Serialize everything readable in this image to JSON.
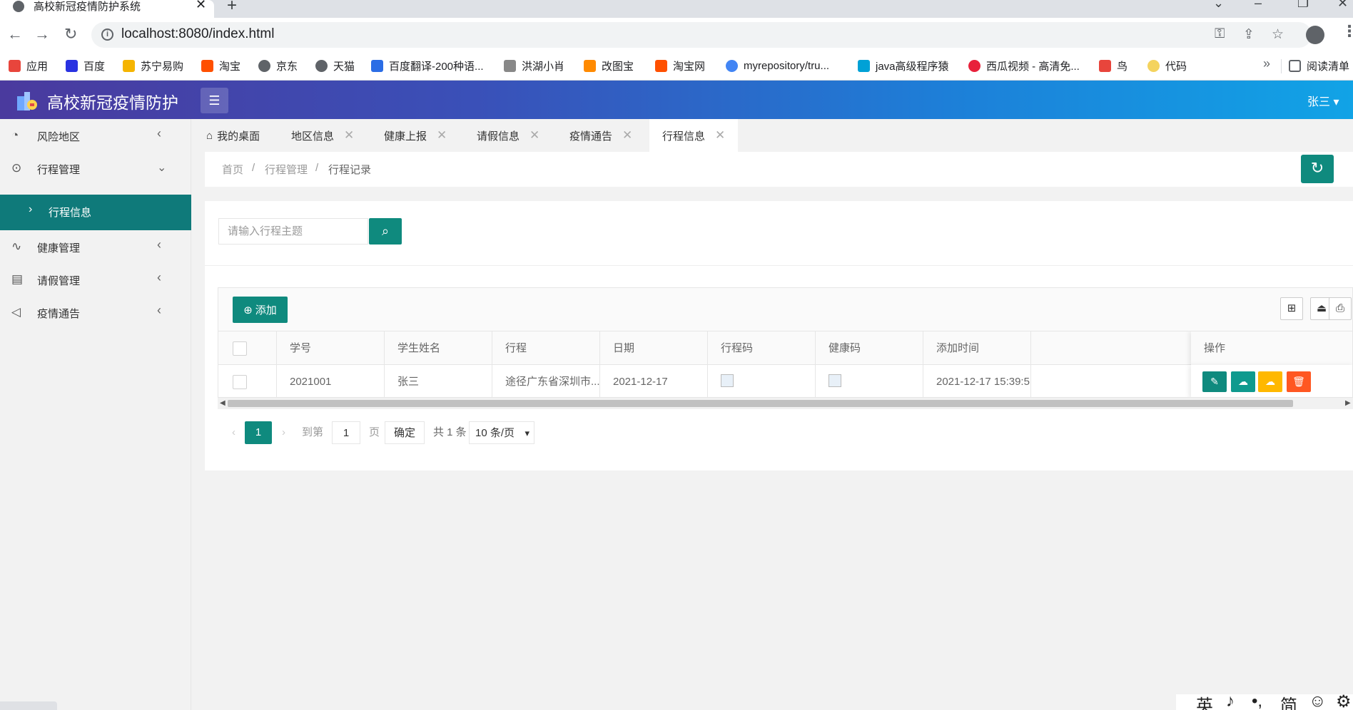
{
  "browser": {
    "tab_title": "高校新冠疫情防护系统",
    "tab_close": "✕",
    "new_tab": "+",
    "url": "localhost:8080/index.html",
    "bookmarks": [
      {
        "label": "应用",
        "color": "#e8453c"
      },
      {
        "label": "百度",
        "color": "#2932e1"
      },
      {
        "label": "苏宁易购",
        "color": "#f5b400"
      },
      {
        "label": "淘宝",
        "color": "#ff5000"
      },
      {
        "label": "京东",
        "color": "#5f6368"
      },
      {
        "label": "天猫",
        "color": "#5f6368"
      },
      {
        "label": "百度翻译-200种语...",
        "color": "#2b6de5"
      },
      {
        "label": "洪湖小肖",
        "color": "#888888"
      },
      {
        "label": "改图宝",
        "color": "#ff8a00"
      },
      {
        "label": "淘宝网",
        "color": "#ff5000"
      },
      {
        "label": "myrepository/tru...",
        "color": "#4285f4"
      },
      {
        "label": "java高级程序猿",
        "color": "#00a1d6"
      },
      {
        "label": "西瓜视频 - 高清免...",
        "color": "#e8213b"
      },
      {
        "label": "鸟",
        "color": "#e8453c"
      },
      {
        "label": "代码",
        "color": "#f4d35e"
      }
    ],
    "bookmarks_more": "»",
    "reading_list": "阅读清单"
  },
  "app": {
    "title": "高校新冠疫情防护",
    "user": "张三 ▾",
    "brand_color": "#0f8a7e"
  },
  "sidebar": {
    "items": [
      {
        "label": "风险地区",
        "icon": "map-icon"
      },
      {
        "label": "行程管理",
        "icon": "location-icon"
      },
      {
        "label": "健康管理",
        "icon": "chart-icon"
      },
      {
        "label": "请假管理",
        "icon": "document-icon"
      },
      {
        "label": "疫情通告",
        "icon": "megaphone-icon"
      }
    ],
    "sub_item": "行程信息"
  },
  "tabs": [
    {
      "label": "我的桌面"
    },
    {
      "label": "地区信息"
    },
    {
      "label": "健康上报"
    },
    {
      "label": "请假信息"
    },
    {
      "label": "疫情通告"
    },
    {
      "label": "行程信息"
    }
  ],
  "breadcrumb": {
    "home": "首页",
    "sep": "/",
    "section": "行程管理",
    "current": "行程记录"
  },
  "search": {
    "placeholder": "请输入行程主题"
  },
  "toolbar": {
    "add_label": "添加"
  },
  "table": {
    "columns": [
      "学号",
      "学生姓名",
      "行程",
      "日期",
      "行程码",
      "健康码",
      "添加时间",
      "操作"
    ],
    "rows": [
      {
        "student_id": "2021001",
        "name": "张三",
        "trip": "途径广东省深圳市...",
        "date": "2021-12-17",
        "added_time": "2021-12-17 15:39:5"
      }
    ]
  },
  "pager": {
    "current_page": "1",
    "goto_label": "到第",
    "goto_value": "1",
    "page_unit": "页",
    "confirm": "确定",
    "total": "共 1 条",
    "page_size": "10 条/页"
  },
  "ime": [
    "英",
    "♪",
    "•,",
    "简",
    "☺",
    "⚙"
  ]
}
